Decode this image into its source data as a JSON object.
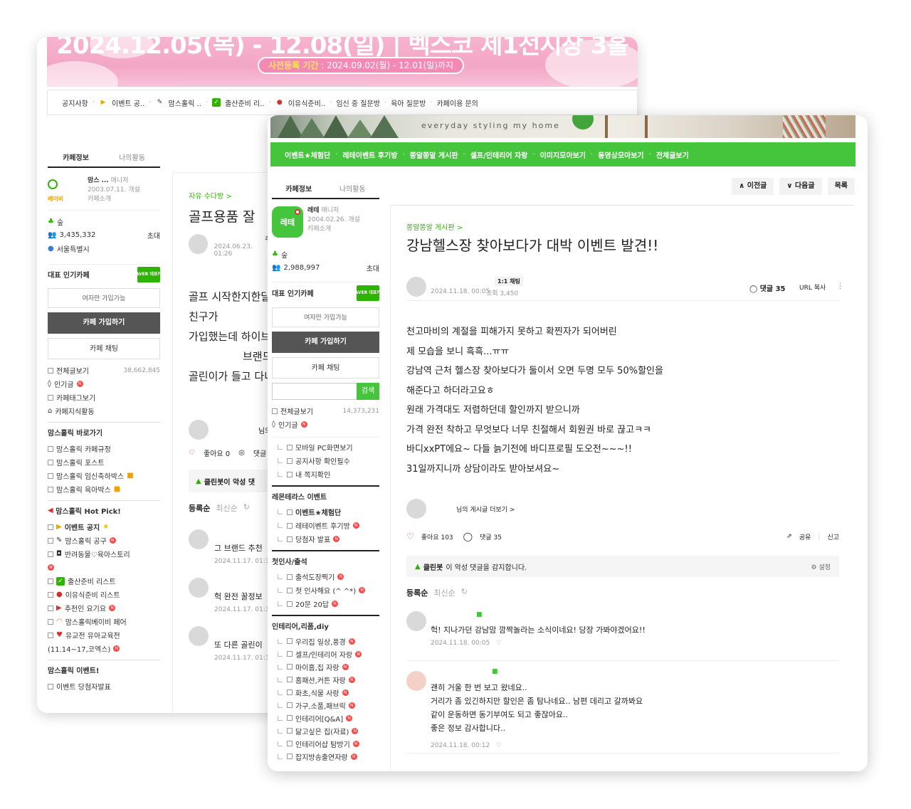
{
  "back": {
    "banner": {
      "headline": "2024.12.05(목) - 12.08(일) | 벡스코 제1전시장 3홀",
      "prereg_label": "사전등록 기간",
      "prereg_dates": " : 2024.09.02(월) - 12.01(일)까지"
    },
    "menu": [
      "공지사항",
      "이벤트 공..",
      "맘스홀릭 ..",
      "출산준비 리..",
      "이유식준비..",
      "임신 중 질문방",
      "육아 질문방",
      "카페이용 문의"
    ],
    "sidebar": {
      "tab_info": "카페정보",
      "tab_activity": "나의활동",
      "cafe_name": "맘스",
      "cafe_name_suffix": "...",
      "manager": "매니저",
      "logo_text": "베이비",
      "founded": "2003.07.11. 개설",
      "intro": "카페소개",
      "level": "숲",
      "members": "3,435,332",
      "invite": "초대",
      "location": "서울특별시",
      "popular_label": "대표 인기카페",
      "naver_badge": "NAVER 대표카페",
      "women_only": "여자만 가입가능",
      "join": "카페 가입하기",
      "chat": "카페 채팅",
      "all_posts": "전체글보기",
      "all_posts_count": "38,662,845",
      "popular_posts": "인기글",
      "tags": "카페태그보기",
      "knowledge": "카페지식활동",
      "shortcut_head": "맘스홀릭 바로가기",
      "shortcuts": [
        "맘스홀릭 카페규정",
        "맘스홀릭 포스트",
        "맘스홀릭 임신축하박스",
        "맘스홀릭 육아박스"
      ],
      "hotpick_head": "맘스홀릭 Hot Pick!",
      "hotpicks": [
        "이벤트 공지",
        "맘스홀릭 공구",
        "반려동물♡육아스토리",
        "출산준비 리스트",
        "이유식준비 리스트",
        "추천인 요기요",
        "맘스홀릭베이비 페어",
        "유교전 유아교육전"
      ],
      "hotpick_extra": "(11.14~17,코엑스)",
      "event_head": "맘스홀릭 이벤트!",
      "event_cut": "이벤트 당첨자발표"
    },
    "main": {
      "board": "자유 수다방 >",
      "title": "골프용품 잘",
      "author_cut": "주",
      "date": "2024.06.23. 01:26",
      "body": [
        "골프 시작한지한달",
        "친구가",
        "가입했는데 하이브",
        "브랜드",
        "골린이가 들고 다니"
      ],
      "author2_cut": "님의",
      "like": "좋아요 0",
      "comment_cut": "댓글",
      "cleanbot": "클린봇이 악성 댓",
      "sort": "등록순",
      "sort_latest": "최신순",
      "comments": [
        {
          "text": "그 브랜드 추천",
          "date": "2024.11.17. 01:3"
        },
        {
          "text": "헉 완전 꿀정보",
          "date": "2024.11.17. 01:3"
        },
        {
          "text": "또 다른 골린이",
          "date": "2024.11.17. 01:3"
        }
      ]
    }
  },
  "front": {
    "banner_tagline": "everyday styling my home",
    "menu": [
      "이벤트★체험단",
      "레테이벤트 후기방",
      "쫑알쫑알 게시판",
      "셀프/인테리어 자랑",
      "이미지모아보기",
      "동영상모아보기",
      "전체글보기"
    ],
    "sidebar": {
      "tab_info": "카페정보",
      "tab_activity": "나의활동",
      "cafe_name": "레테",
      "manager": "매니저",
      "logo_text": "레테",
      "founded": "2004.02.26. 개설",
      "intro": "카페소개",
      "level": "숲",
      "members": "2,988,997",
      "invite": "초대",
      "popular_label": "대표 인기카페",
      "naver_badge": "NAVER 대표카페",
      "women_only": "여자만 가입가능",
      "join": "카페 가입하기",
      "chat": "카페 채팅",
      "search_btn": "검색",
      "search_placeholder": "",
      "all_posts": "전체글보기",
      "all_posts_count": "14,373,231",
      "popular_posts": "인기글",
      "quick": [
        "모바일 PC화면보기",
        "공지사항 확인필수",
        "내 쪽지확인"
      ],
      "event_head": "레몬테라스 이벤트",
      "events": [
        "이벤트★체험단",
        "레테이벤트 후기방",
        "당첨자 발표"
      ],
      "greet_head": "첫인사/출석",
      "greets": [
        "출석도장찍기",
        "첫 인사해요 (^ ^*)",
        "20문 20답"
      ],
      "interior_head": "인테리어,리폼,diy",
      "interiors": [
        "우리집 일상,풍경",
        "셀프/인테리어 자랑",
        "마이홈,집 자랑",
        "홈패션,커튼 자랑",
        "화초,식물 사랑",
        "가구,소품,패브릭",
        "인테리어[Q&A]",
        "닮고싶은 집(자료)",
        "인테리어샵 탐방기",
        "잡지방송출연자랑"
      ]
    },
    "nav": {
      "prev": "이전글",
      "next": "다음글",
      "list": "목록"
    },
    "post": {
      "board": "쫑알쫑알 게시판 >",
      "title": "강남헬스장 찾아보다가 대박 이벤트 발견!!",
      "chat": "1:1 채팅",
      "date": "2024.11.18. 00:05",
      "views": "조회 3,450",
      "comment_count": "댓글 35",
      "url_copy": "URL 복사",
      "body": [
        "천고마비의 계절을 피해가지 못하고 확찐자가 되어버린",
        "제 모습을 보니 흑흑...ㅠㅠ",
        "강남역 근처 헬스장 찾아보다가 둘이서 오면 두명 모두 50%할인을",
        "해준다고 하더라고요ㅎ",
        "원래 가격대도 저렴하던데 할인까지 받으니까",
        "가격 완전 착하고 무엇보다 너무 친절해서 회원권 바로 끊고ㅋㅋ",
        "바디xxPT에요~ 다들 늙기전에 바디프로필 도오전~~~!!",
        "31일까지니까 상담이라도 받아보셔요~"
      ],
      "more_posts": "님의 게시글 더보기 >",
      "like": "좋아요 103",
      "comments_label": "댓글 35",
      "share": "공유",
      "report": "신고",
      "cleanbot_name": "클린봇",
      "cleanbot_text": "이 악성 댓글을 감지합니다.",
      "settings": "설정",
      "sort": "등록순",
      "sort_latest": "최신순",
      "comments": [
        {
          "lines": [
            "헉! 지나가던 강남맘 깜짝놀라는 소식이네요! 당장 가봐야겠어요!!"
          ],
          "date": "2024.11.18. 00:05"
        },
        {
          "lines": [
            "괜히 거울 한 번 보고 왔네요..",
            "거리가 좀 있긴하지만 할인은 좀 탐나네요.. 남편 데리고 갈까봐요",
            "같이 운동하면 동기부여도 되고 좋잖아요..",
            "좋은 정보 감사합니다.."
          ],
          "date": "2024.11.18. 00:12"
        }
      ]
    }
  },
  "colors": {
    "naver_green": "#2db400",
    "menu_green": "#44c53c",
    "banner_pink": "#f3a6c6",
    "like_red": "#e53935"
  }
}
